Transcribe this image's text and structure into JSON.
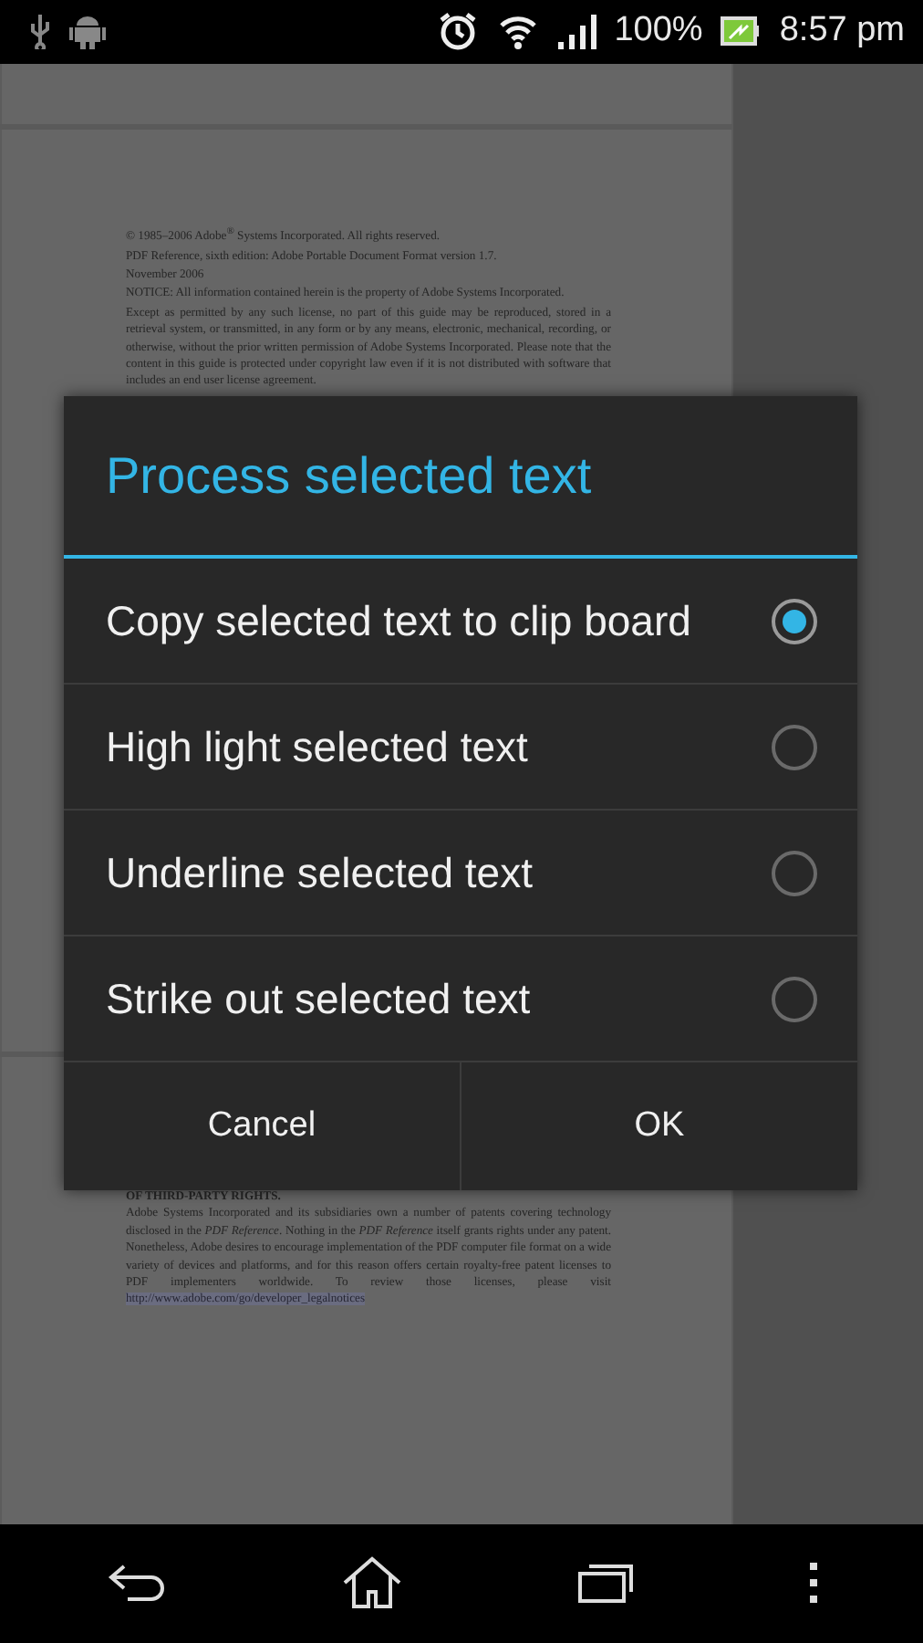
{
  "status_bar": {
    "battery": "100%",
    "time": "8:57 pm"
  },
  "document": {
    "page_1_paragraphs": [
      "© 1985–2006 Adobe$^{®}$ Systems Incorporated. All rights reserved.",
      "PDF Reference, sixth edition: Adobe Portable Document Format version 1.7.",
      "November 2006",
      "NOTICE: All information contained herein is the property of Adobe Systems Incorporated.",
      "Except as permitted by any such license, no part of this guide may be reproduced, stored in a retrieval system, or transmitted, in any form or by any means, electronic, mechanical, recording, or otherwise, without the prior written permission of Adobe Systems Incorporated. Please note that the content in this guide is protected under copyright law even if it is not distributed with software that includes an end user license agreement."
    ],
    "page_2": {
      "heading": "OF THIRD-PARTY RIGHTS.",
      "paragraph": "Adobe Systems Incorporated and its subsidiaries own a number of patents covering technology disclosed in the *PDF Reference*. Nothing in the *PDF Reference* itself grants rights under any patent. Nonetheless, Adobe desires to encourage implementation of the PDF computer file format on a wide variety of devices and platforms, and for this reason offers certain royalty-free patent licenses to PDF implementers worldwide. To review those licenses, please visit",
      "link": "http://www.adobe.com/go/developer_legalnotices"
    }
  },
  "dialog": {
    "title": "Process selected text",
    "options": [
      {
        "label": "Copy selected text to clip board",
        "selected": true
      },
      {
        "label": "High light selected text",
        "selected": false
      },
      {
        "label": "Underline selected text",
        "selected": false
      },
      {
        "label": "Strike out selected text",
        "selected": false
      }
    ],
    "buttons": [
      "Cancel",
      "OK"
    ]
  }
}
